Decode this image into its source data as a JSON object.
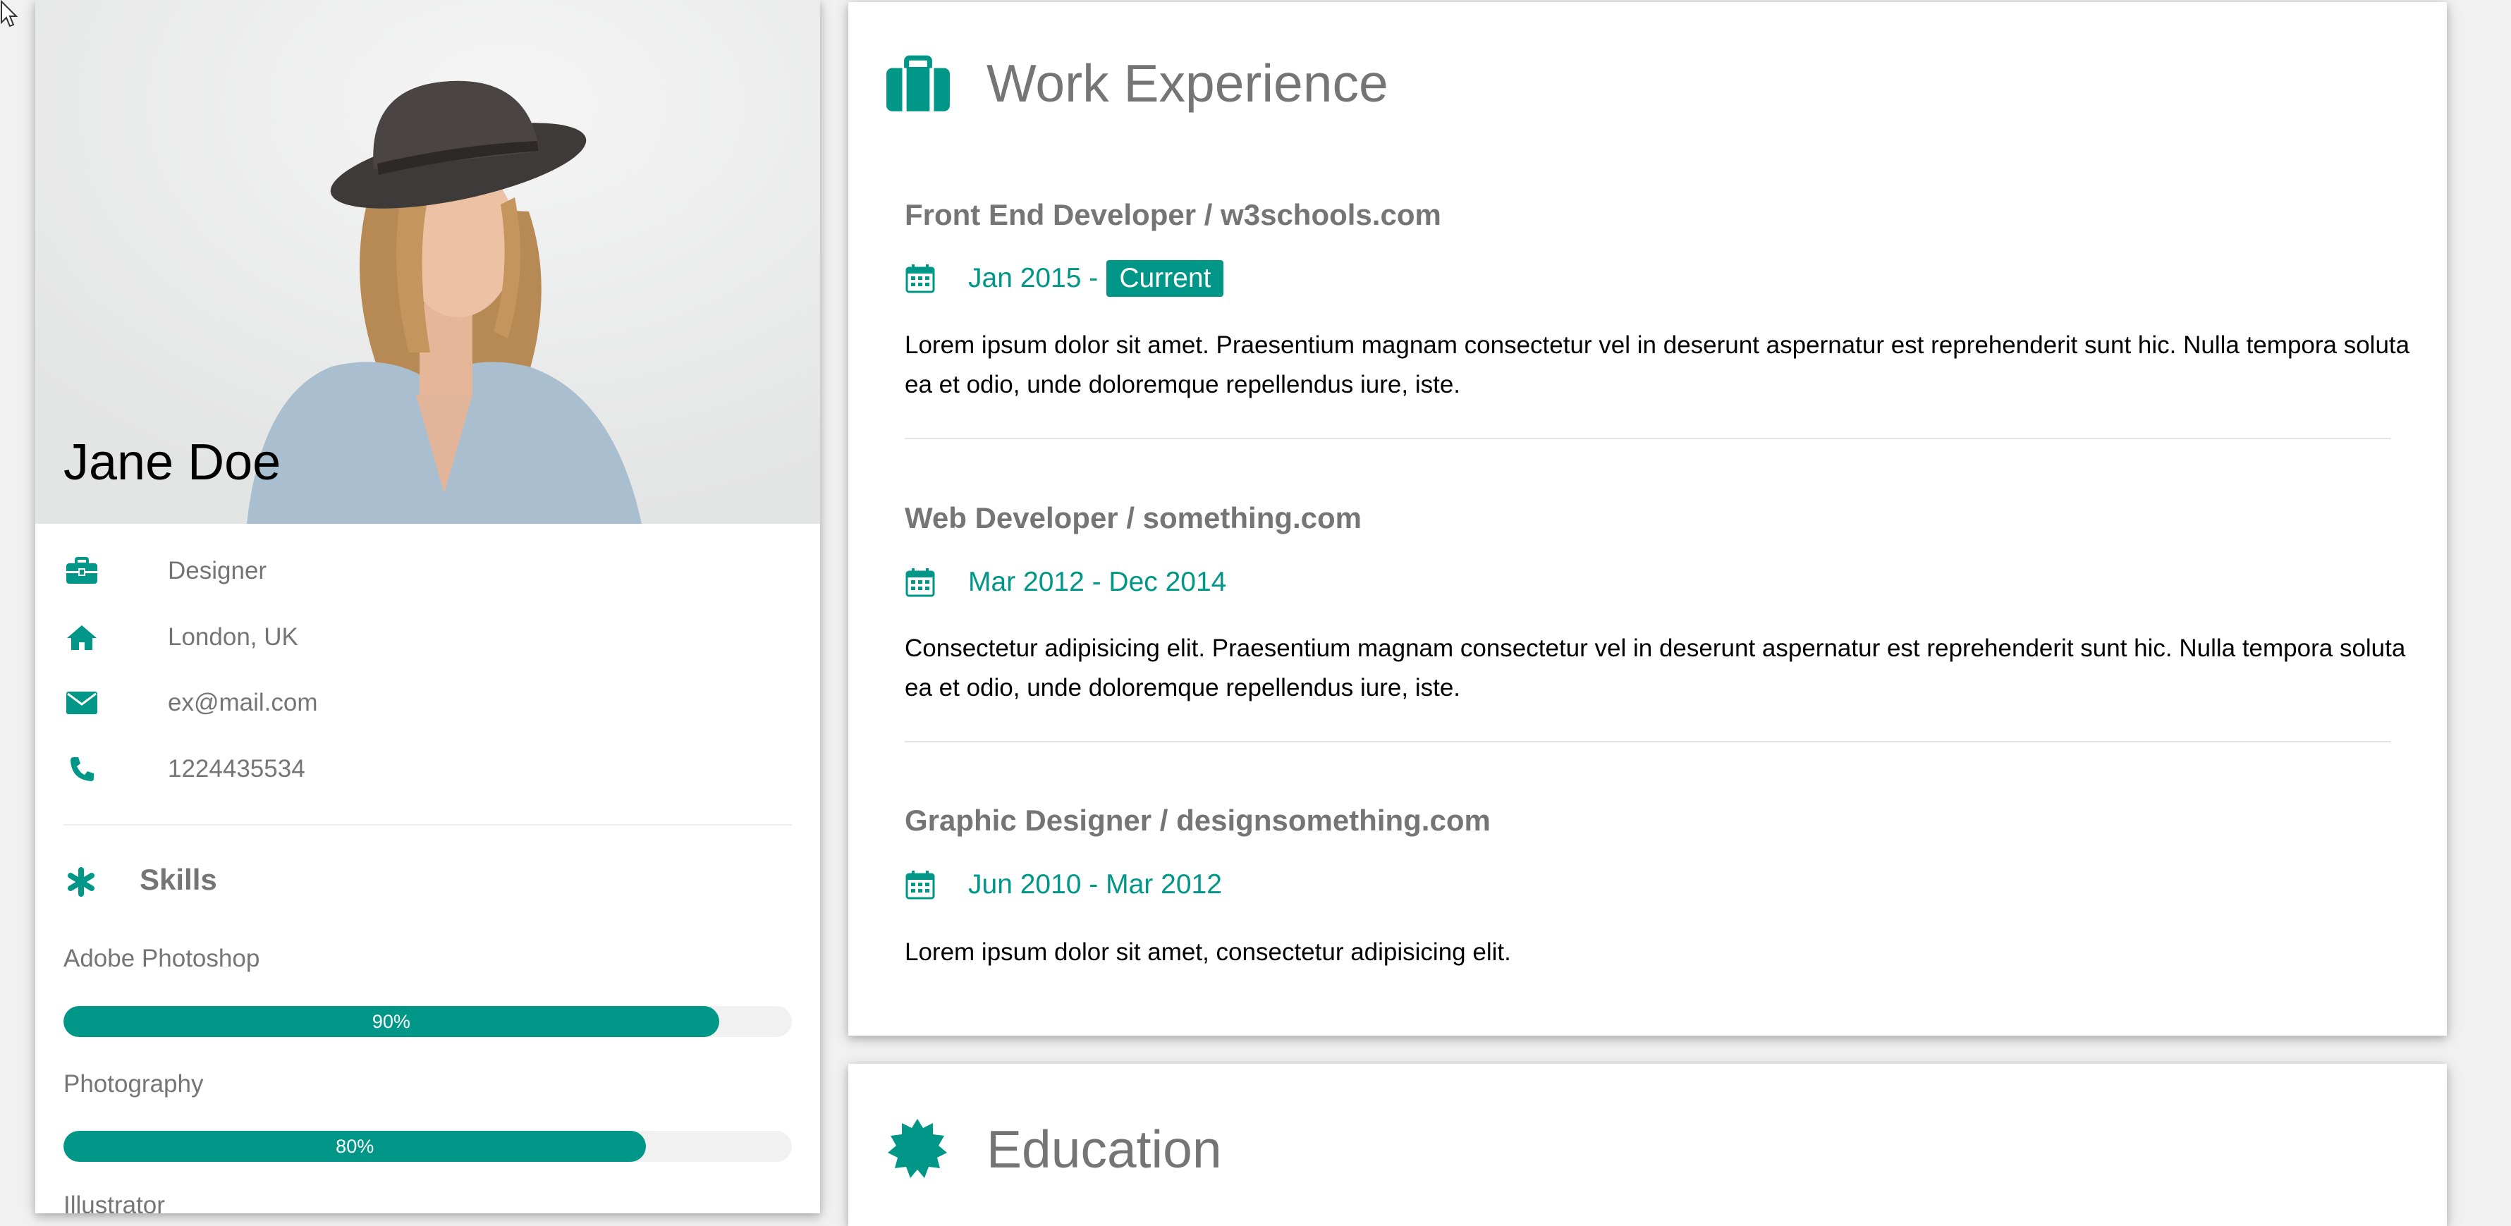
{
  "profile": {
    "name": "Jane Doe",
    "details": [
      {
        "icon": "briefcase-icon",
        "text": "Designer"
      },
      {
        "icon": "home-icon",
        "text": "London, UK"
      },
      {
        "icon": "envelope-icon",
        "text": "ex@mail.com"
      },
      {
        "icon": "phone-icon",
        "text": "1224435534"
      }
    ]
  },
  "skills": {
    "title": "Skills",
    "icon": "asterisk-icon",
    "items": [
      {
        "label": "Adobe Photoshop",
        "percent_label": "90%",
        "value": 90
      },
      {
        "label": "Photography",
        "percent_label": "80%",
        "value": 80
      },
      {
        "label": "Illustrator",
        "percent_label": "",
        "value": null
      }
    ]
  },
  "work": {
    "title": "Work Experience",
    "icon": "briefcase-icon",
    "jobs": [
      {
        "title": "Front End Developer / w3schools.com",
        "date": "Jan 2015 -",
        "tag": "Current",
        "description": "Lorem ipsum dolor sit amet. Praesentium magnam consectetur vel in deserunt aspernatur est reprehenderit sunt hic. Nulla tempora soluta ea et odio, unde doloremque repellendus iure, iste."
      },
      {
        "title": "Web Developer / something.com",
        "date": "Mar 2012 - Dec 2014",
        "description": "Consectetur adipisicing elit. Praesentium magnam consectetur vel in deserunt aspernatur est reprehenderit sunt hic. Nulla tempora soluta ea et odio, unde doloremque repellendus iure, iste."
      },
      {
        "title": "Graphic Designer / designsomething.com",
        "date": "Jun 2010 - Mar 2012",
        "description": "Lorem ipsum dolor sit amet, consectetur adipisicing elit."
      }
    ]
  },
  "education": {
    "title": "Education",
    "icon": "certificate-icon"
  },
  "colors": {
    "accent": "#009688",
    "muted_text": "#757575",
    "page_background": "#f1f1f1"
  }
}
